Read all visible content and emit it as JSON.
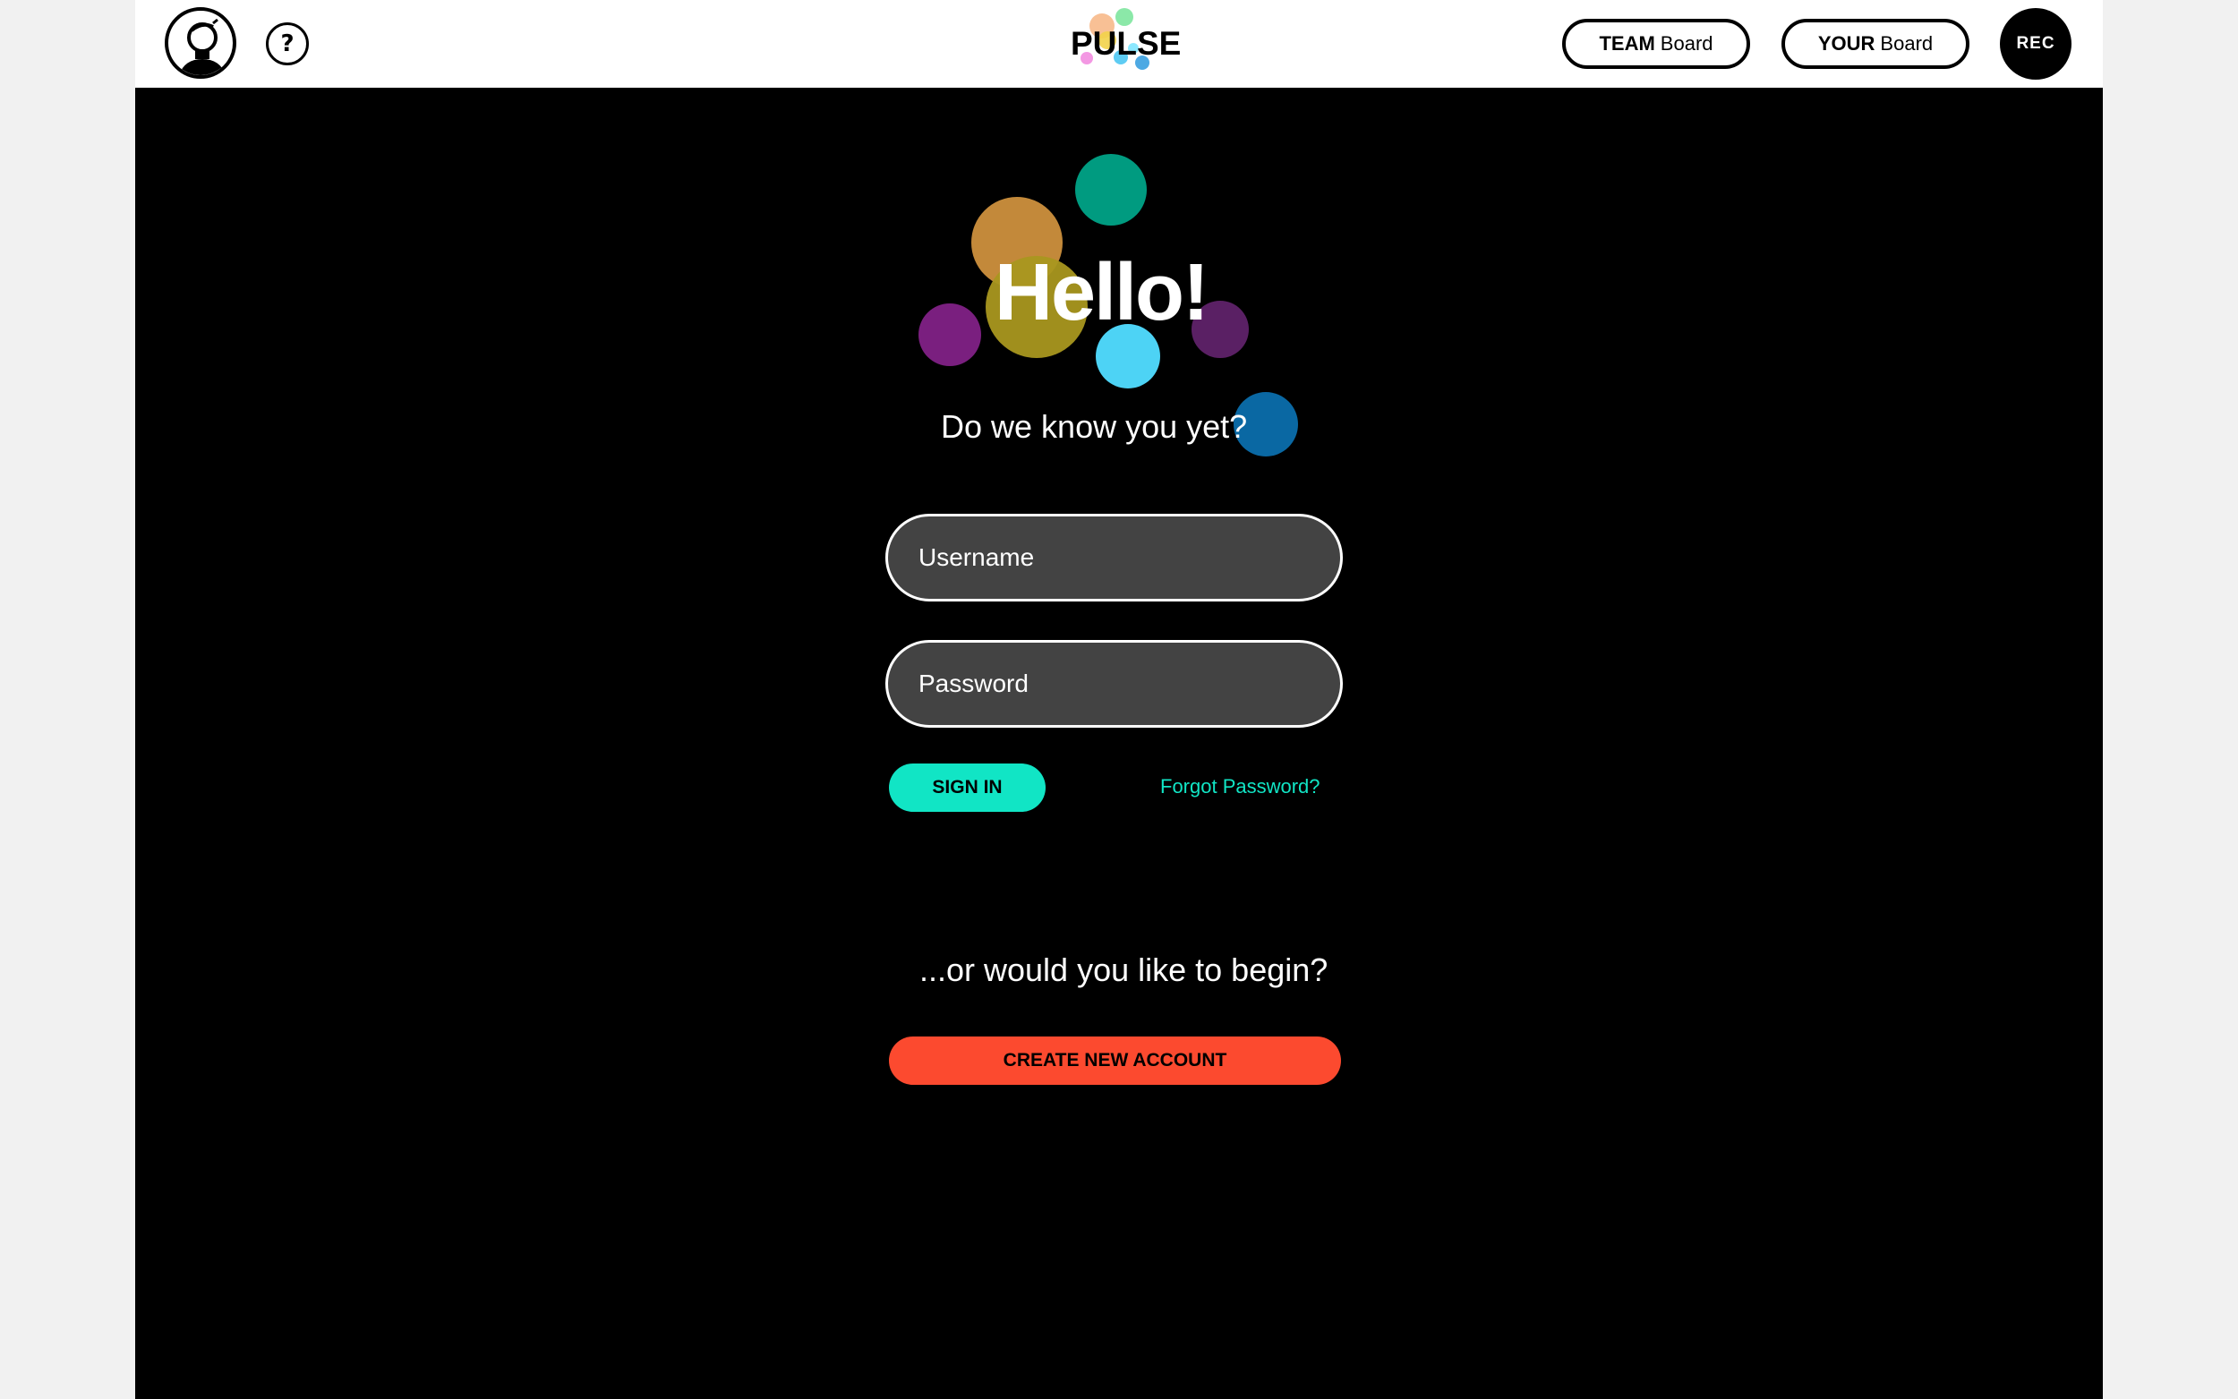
{
  "header": {
    "logo_text": "PULSE",
    "help_label": "?",
    "team_board": {
      "strong": "TEAM",
      "rest": "Board"
    },
    "your_board": {
      "strong": "YOUR",
      "rest": "Board"
    },
    "rec_label": "REC"
  },
  "login": {
    "greeting": "Hello!",
    "subtitle": "Do we know you yet?",
    "username_placeholder": "Username",
    "password_placeholder": "Password",
    "signin_label": "SIGN IN",
    "forgot_label": "Forgot Password?"
  },
  "signup": {
    "prompt": "...or would you like to begin?",
    "create_label": "CREATE NEW ACCOUNT"
  },
  "colors": {
    "accent_teal": "#11e5c5",
    "accent_red": "#fc4a2f",
    "field_bg": "#434343",
    "bubble_teal": "#009b80",
    "bubble_orange": "#c3893a",
    "bubble_olive": "#a9971f",
    "bubble_purple": "#7a1f7f",
    "bubble_cyan": "#4dd3f5",
    "bubble_plum": "#5a2064",
    "bubble_blue": "#0a68a3"
  },
  "icons": {
    "avatar": "user-avatar-icon",
    "help": "help-icon"
  }
}
